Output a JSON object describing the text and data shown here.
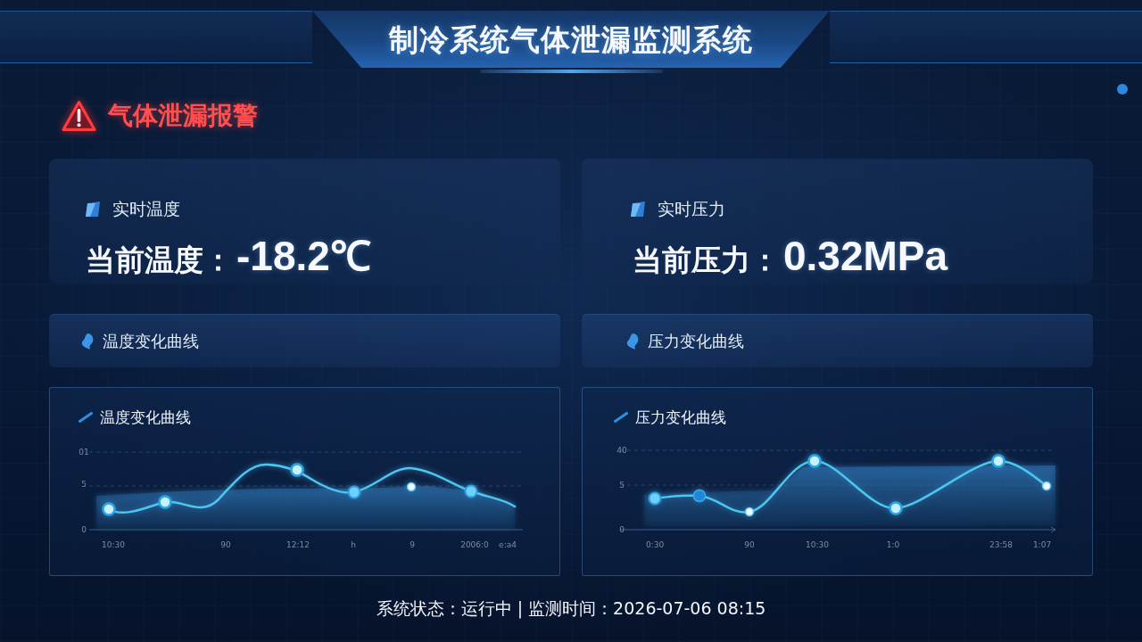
{
  "header": {
    "title": "制冷系统气体泄漏监测系统"
  },
  "alert": {
    "text": "气体泄漏报警"
  },
  "readings": [
    {
      "title": "实时温度",
      "label": "当前温度：",
      "value": "-18.2℃"
    },
    {
      "title": "实时压力",
      "label": "当前压力：",
      "value": "0.32MPa"
    }
  ],
  "curve_headers": [
    "温度变化曲线",
    "压力变化曲线"
  ],
  "charts": [
    {
      "kind": "temperature",
      "title": "温度变化曲线",
      "y_ticks": [
        "01",
        "5",
        "0"
      ],
      "x_labels": [
        "10:30",
        "90",
        "12:12",
        "h",
        "9",
        "2006:0",
        "e:a4"
      ]
    },
    {
      "kind": "pressure",
      "title": "压力变化曲线",
      "y_ticks": [
        "40",
        "5",
        "0"
      ],
      "x_labels": [
        "0:30",
        "90",
        "10:30",
        "1:0",
        "23:58",
        "1:07"
      ]
    }
  ],
  "status_bar": {
    "text": "系统状态：运行中 | 监测时间：2026-07-06 08:15"
  }
}
